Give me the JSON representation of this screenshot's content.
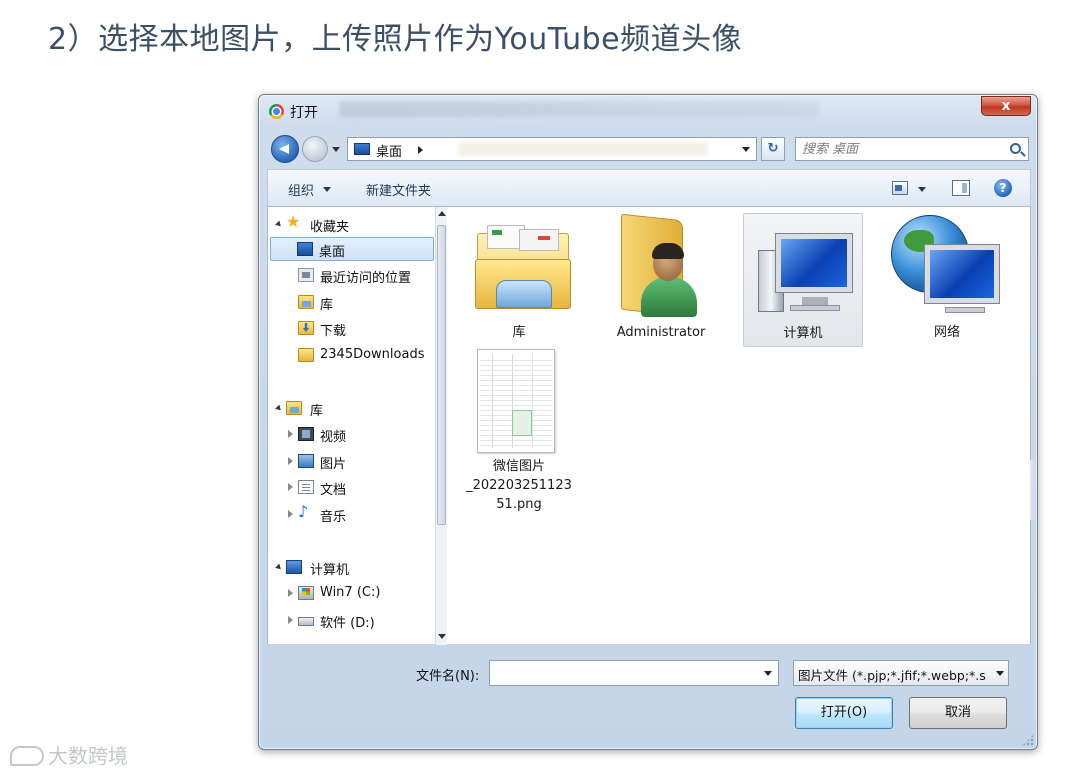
{
  "heading": "2）选择本地图片，上传照片作为YouTube频道头像",
  "window": {
    "title": "打开",
    "close_symbol": "x"
  },
  "address": {
    "location": "桌面",
    "refresh_symbol": "↻"
  },
  "search": {
    "placeholder": "搜索 桌面"
  },
  "toolbar": {
    "organize": "组织 ",
    "new_folder": "新建文件夹",
    "help_symbol": "?"
  },
  "nav": {
    "favorites": "收藏夹",
    "desktop": "桌面",
    "recent": "最近访问的位置",
    "library_fav": "库",
    "downloads": "下载",
    "download_folder": "2345Downloads",
    "libraries": "库",
    "videos": "视频",
    "pictures": "图片",
    "documents": "文档",
    "music": "音乐",
    "computer": "计算机",
    "drive_c": "Win7 (C:)",
    "drive_d": "软件 (D:)"
  },
  "items": {
    "library": "库",
    "administrator": "Administrator",
    "computer": "计算机",
    "network": "网络",
    "image_line1": "微信图片",
    "image_line2": "_202203251123",
    "image_line3": "51.png"
  },
  "footer": {
    "filename_label": "文件名(N):",
    "filename_value": "",
    "filetype": "图片文件 (*.pjp;*.jfif;*.webp;*.s",
    "open_button": "打开(O)",
    "cancel_button": "取消"
  },
  "watermark": "大数跨境",
  "colors": {
    "heading": "#3b4f66",
    "accent": "#2864b8",
    "close": "#c0351f"
  }
}
